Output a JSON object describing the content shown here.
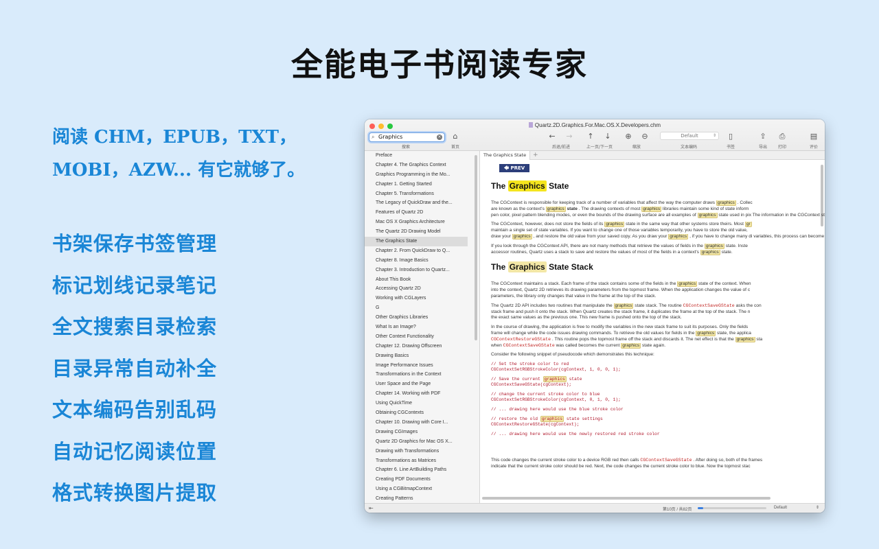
{
  "headline": "全能电子书阅读专家",
  "intro": {
    "line1": "阅读 CHM，EPUB，TXT，",
    "line2": "MOBI，AZW... 有它就够了。"
  },
  "features": [
    "书架保存书签管理",
    "标记划线记录笔记",
    "全文搜索目录检索",
    "目录异常自动补全",
    "文本编码告别乱码",
    "自动记忆阅读位置",
    "格式转换图片提取"
  ],
  "window": {
    "title": "Quartz.2D.Graphics.For.Mac.OS.X.Developers.chm",
    "search": {
      "value": "Graphics",
      "label": "搜索"
    },
    "toolbar": {
      "home": "首页",
      "back_forward": "后退/前进",
      "prev_next": "上一页/下一页",
      "zoom": "缩放",
      "encoding_value": "Default",
      "encoding": "文本编码",
      "bookmark": "书签",
      "export": "导出",
      "print": "打印",
      "review": "评价"
    },
    "sidebar": {
      "items": [
        "Preface",
        "Chapter 4.  The Graphics Context",
        "Graphics Programming in the Mo...",
        "Chapter 1.  Getting Started",
        "Chapter 5.  Transformations",
        "The Legacy of QuickDraw and the...",
        "Features of Quartz 2D",
        "Mac OS X Graphics Architecture",
        "The Quartz 2D Drawing Model",
        "The Graphics State",
        "Chapter 2.  From QuickDraw to Q...",
        "Chapter 8.  Image Basics",
        "Chapter 3.  Introduction to Quartz...",
        "About This Book",
        "Accessing Quartz 2D",
        "Working with CGLayers",
        "G",
        "Other Graphics Libraries",
        "What Is an Image?",
        "Other Context Functionality",
        "Chapter 12.  Drawing Offscreen",
        "Drawing Basics",
        "Image Performance Issues",
        "Transformations in the Context",
        "User Space and the Page",
        "Chapter 14.  Working with PDF",
        "Using QuickTime",
        "Obtaining CGContexts",
        "Chapter 10.  Drawing with Core I...",
        "Drawing CGImages",
        "Quartz 2D Graphics for Mac OS X...",
        "Drawing with Transformations",
        "Transformations as Matrices",
        "Chapter 6.  Line ArtBuilding Paths",
        "Creating PDF Documents",
        "Using a CGBitmapContext",
        "Creating Patterns"
      ],
      "selected_index": 9
    },
    "tab_label": "The Graphics State",
    "doc": {
      "prev": "PREV",
      "h1_pre": "The",
      "h1_kw": "Graphics",
      "h1_post": "State",
      "p1": [
        "The CGContext is responsible for keeping track of a number of variables that affect the way the computer draws",
        "graphics",
        ". Collec",
        "are known as the context's",
        "graphics",
        "state",
        ". The drawing contexts of most",
        "graphics",
        "libraries maintain some kind of state inform",
        "pen color, pixel pattern blending modes, or even the bounds of the drawing surface are all examples of",
        "graphics",
        "state used in pix",
        "The information in the CGContext state is very similar."
      ],
      "p2": [
        "The CGContext, however, does not store the fields of its",
        "graphics",
        "state in the same way that other systems store theirs. Most",
        "gr",
        "maintain a single set of state variables. If you want to change one of those variables temporarily, you have to store the old value,",
        "draw your",
        "graphics",
        ", and restore the old value from your saved copy. As you draw your",
        "graphics",
        ", if you have to change many di",
        "variables, this process can become tedious and error prone."
      ],
      "p3": [
        "If you look through the CGContext API, there are not many methods that retrieve the values of fields in the",
        "graphics",
        "state. Inste",
        "accessor routines, Quartz uses a stack to save and restore the values of most of the fields in a context's",
        "graphics",
        "state."
      ],
      "h2_pre": "The",
      "h2_kw": "Graphics",
      "h2_post": "State Stack",
      "p4": [
        "The CGContext maintains a stack. Each frame of the stack contains some of the fields in the",
        "graphics",
        "state of the context. When",
        "into the context, Quartz 2D retrieves its drawing parameters from the topmost frame. When the application changes the value of c",
        "parameters, the library only changes that value in the frame at the top of the stack."
      ],
      "p5": [
        "The Quartz 2D API includes two routines that manipulate the",
        "graphics",
        "state stack. The routine",
        "CGContextSaveGState",
        "asks the con",
        "stack frame and push it onto the stack. When Quartz creates the stack frame, it duplicates the frame at the top of the stack. The n",
        "the exact same values as the previous one. This new frame is pushed onto the top of the stack."
      ],
      "p6": [
        "In the course of drawing, the application is free to modify the variables in the new stack frame to suit its purposes. Only the fields",
        "frame will change while the code issues drawing commands. To retrieve the old values for fields in the",
        "graphics",
        "state, the applica",
        "CGContextRestoreGState",
        ". This routine pops the topmost frame off the stack and discards it. The net effect is that the",
        "graphics",
        "sta",
        "when",
        "CGContextSaveGState",
        "was called becomes the current",
        "graphics",
        "state again."
      ],
      "p7": "Consider the following snippet of pseudocode which demonstrates this technique:",
      "code": [
        "// Set the stroke color to red",
        "CGContextSetRGBStrokeColor(cgContext, 1, 0, 0, 1);",
        "// Save the current",
        "graphics",
        "state",
        "CGContextSaveGState(cgContext);",
        "// change the current stroke color to blue",
        "CGContextSetRGBStrokeColor(cgContext, 0, 1, 0, 1);",
        "// ... drawing here would use the blue stroke color",
        "// restore the old",
        "graphics",
        "state settings",
        "CGContextRestoreGState(cgContext);",
        "// ... drawing here would use the newly restored red stroke color"
      ],
      "p8": [
        "This code changes the current stroke color to a device RGB red then calls",
        "CGContextSaveGState",
        ". After doing so, both of the frames",
        "indicate that the current stroke color should be red. Next, the code changes the current stroke color to blue. Now the topmost stac"
      ]
    },
    "status": {
      "page": "第10页 / 共82页",
      "default": "Default"
    }
  }
}
